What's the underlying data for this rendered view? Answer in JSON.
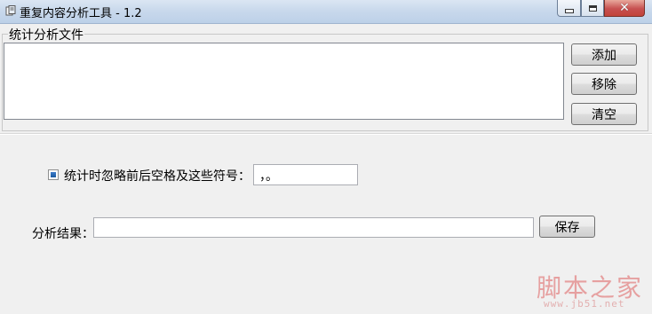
{
  "window": {
    "title": "重复内容分析工具 - 1.2",
    "icon": "app-tool-icon",
    "controls": {
      "minimize_icon": "minimize-icon",
      "maximize_icon": "maximize-icon",
      "close_glyph": "✕"
    }
  },
  "files_group": {
    "legend": "统计分析文件",
    "files": [],
    "buttons": {
      "add": "添加",
      "remove": "移除",
      "clear": "清空"
    }
  },
  "options": {
    "ignore_label": "统计时忽略前后空格及这些符号：",
    "ignore_checked": true,
    "symbols_value": "，。"
  },
  "result": {
    "label": "分析结果：",
    "value": "",
    "save_label": "保存"
  },
  "watermark": {
    "main": "脚本之家",
    "url": "www.jb51.net"
  },
  "colors": {
    "window_bg": "#f0f0f0",
    "close_button": "#c75050",
    "checkbox_fill": "#1c5a9f"
  }
}
